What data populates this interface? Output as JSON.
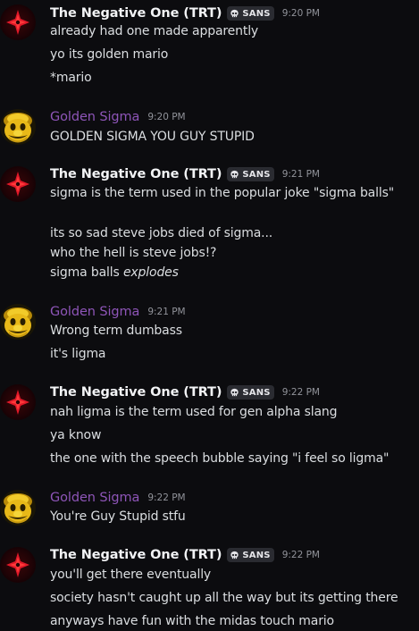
{
  "users": {
    "negative": {
      "name": "The Negative One (TRT)",
      "tag": "SANS",
      "avatar_icon": "red-star-icon"
    },
    "golden": {
      "name": "Golden Sigma",
      "avatar_icon": "golden-mario-face-icon"
    }
  },
  "colors": {
    "background": "#0c0c0f",
    "golden_name": "#8e55b8",
    "timestamp": "#91939a",
    "tag_bg": "#2a2b31"
  },
  "messages": [
    {
      "author": "The Negative One (TRT)",
      "tag": "SANS",
      "time": "9:20 PM",
      "lines": [
        "already had one made apparently",
        "yo its golden mario",
        "*mario"
      ]
    },
    {
      "author": "Golden Sigma",
      "time": "9:20 PM",
      "lines": [
        "GOLDEN SIGMA YOU GUY STUPID"
      ]
    },
    {
      "author": "The Negative One (TRT)",
      "tag": "SANS",
      "time": "9:21 PM",
      "lines": [
        "sigma is the term used in the popular joke \"sigma balls\"",
        "its so sad steve jobs died of sigma...",
        "who the hell is steve jobs!?",
        "sigma balls"
      ],
      "emphasis": "explodes"
    },
    {
      "author": "Golden Sigma",
      "time": "9:21 PM",
      "lines": [
        "Wrong term dumbass",
        "it's ligma"
      ]
    },
    {
      "author": "The Negative One (TRT)",
      "tag": "SANS",
      "time": "9:22 PM",
      "lines": [
        "nah ligma is the term used for gen alpha slang",
        "ya know",
        "the one with the speech bubble saying \"i feel so ligma\""
      ]
    },
    {
      "author": "Golden Sigma",
      "time": "9:22 PM",
      "lines": [
        "You're Guy Stupid stfu"
      ]
    },
    {
      "author": "The Negative One (TRT)",
      "tag": "SANS",
      "time": "9:22 PM",
      "lines": [
        "you'll get there eventually",
        "society hasn't caught up all the way but its getting there",
        "anyways have fun with the midas touch mario"
      ]
    }
  ]
}
